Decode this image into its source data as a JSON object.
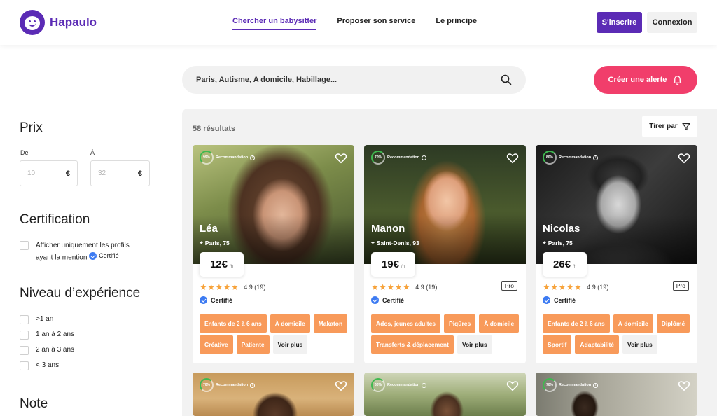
{
  "brand": {
    "name": "Hapaulo",
    "color": "#5b2bb5"
  },
  "nav": {
    "items": [
      {
        "label": "Chercher un babysitter",
        "active": true
      },
      {
        "label": "Proposer son service"
      },
      {
        "label": "Le principe"
      }
    ]
  },
  "auth": {
    "signup": "S'inscrire",
    "login": "Connexion"
  },
  "search": {
    "value": "Paris, Autisme, A domicile, Habillage..."
  },
  "alert": {
    "label": "Créer une alerte"
  },
  "filters": {
    "price": {
      "title": "Prix",
      "from_label": "De",
      "to_label": "À",
      "from_ph": "10",
      "to_ph": "32",
      "currency": "€"
    },
    "certification": {
      "title": "Certification",
      "line1": "Afficher uniquement les profils",
      "line2": "ayant la mention",
      "badge": "Certifié"
    },
    "experience": {
      "title": "Niveau d’expérience",
      "options": [
        ">1 an",
        "1 an à 2 ans",
        "2 an à 3 ans",
        "< 3 ans"
      ]
    },
    "note": {
      "title": "Note"
    }
  },
  "results": {
    "count": "58 résultats",
    "sort_label": "Tirer par"
  },
  "profiles": [
    {
      "name": "Léa",
      "location": "Paris, 75",
      "reco": "99%",
      "reco_label": "Recommandation",
      "price": "12€",
      "unit": "/h",
      "stars": "★★★★★",
      "rating": "4.9 (19)",
      "pro": "",
      "certified": "Certifié",
      "tags": [
        "Enfants de 2 à 6 ans",
        "À domicile",
        "Makaton",
        "Créative",
        "Patiente"
      ],
      "more": "Voir plus"
    },
    {
      "name": "Manon",
      "location": "Saint-Denis, 93",
      "reco": "70%",
      "reco_label": "Recommandation",
      "price": "19€",
      "unit": "/h",
      "stars": "★★★★★",
      "rating": "4.9 (19)",
      "pro": "Pro",
      "certified": "Certifié",
      "tags": [
        "Ados, jeunes adultes",
        "Piqûres",
        "À domicile",
        "Transferts & déplacement"
      ],
      "more": "Voir plus"
    },
    {
      "name": "Nicolas",
      "location": "Paris, 75",
      "reco": "80%",
      "reco_label": "Recommandation",
      "price": "26€",
      "unit": "/h",
      "stars": "★★★★★",
      "rating": "4.9 (19)",
      "pro": "Pro",
      "certified": "Certifié",
      "tags": [
        "Enfants de 2 à 6 ans",
        "À domicile",
        "Diplômé",
        "Sportif",
        "Adaptabilité"
      ],
      "more": "Voir plus"
    },
    {
      "reco": "70%",
      "reco_label": "Recommandation"
    },
    {
      "reco": "60%",
      "reco_label": "Recommandation"
    },
    {
      "reco": "70%",
      "reco_label": "Recommandation"
    }
  ]
}
